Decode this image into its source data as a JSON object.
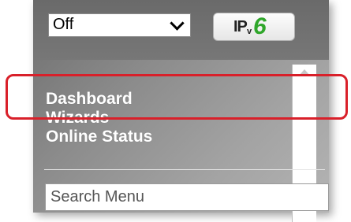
{
  "toolbar": {
    "mode_select_value": "Off",
    "ipv6_button": {
      "ip": "IP",
      "v": "v",
      "six": "6"
    }
  },
  "menu": {
    "items": [
      {
        "label": "Dashboard"
      },
      {
        "label": "Wizards"
      },
      {
        "label": "Online Status"
      }
    ]
  },
  "search": {
    "placeholder": "Search Menu",
    "value": ""
  },
  "highlight": {
    "target": "Dashboard",
    "color": "#d9202a"
  },
  "icons": {
    "select_arrow": "chevron-down-icon",
    "scroll_up": "chevron-up-icon"
  },
  "colors": {
    "ipv6_six": "#2fa62a",
    "menu_text": "#ffffff"
  }
}
